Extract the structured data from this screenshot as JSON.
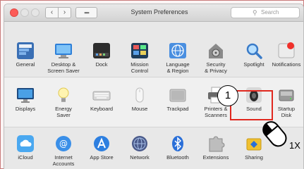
{
  "window": {
    "title": "System Preferences",
    "search_placeholder": "Search",
    "back_glyph": "‹",
    "forward_glyph": "›",
    "grid_glyph": "▪▪▪"
  },
  "row1": [
    {
      "label": "General",
      "icon": "general-icon"
    },
    {
      "label": "Desktop &\nScreen Saver",
      "icon": "desktop-icon"
    },
    {
      "label": "Dock",
      "icon": "dock-icon"
    },
    {
      "label": "Mission\nControl",
      "icon": "mission-control-icon"
    },
    {
      "label": "Language\n& Region",
      "icon": "language-region-icon"
    },
    {
      "label": "Security\n& Privacy",
      "icon": "security-icon"
    },
    {
      "label": "Spotlight",
      "icon": "spotlight-icon"
    },
    {
      "label": "Notifications",
      "icon": "notifications-icon"
    }
  ],
  "row2": [
    {
      "label": "Displays",
      "icon": "displays-icon"
    },
    {
      "label": "Energy\nSaver",
      "icon": "energy-saver-icon"
    },
    {
      "label": "Keyboard",
      "icon": "keyboard-icon"
    },
    {
      "label": "Mouse",
      "icon": "mouse-icon"
    },
    {
      "label": "Trackpad",
      "icon": "trackpad-icon"
    },
    {
      "label": "Printers &\nScanners",
      "icon": "printer-icon"
    },
    {
      "label": "Sound",
      "icon": "sound-icon"
    },
    {
      "label": "Startup\nDisk",
      "icon": "startup-disk-icon"
    }
  ],
  "row3": [
    {
      "label": "iCloud",
      "icon": "icloud-icon"
    },
    {
      "label": "Internet\nAccounts",
      "icon": "internet-accounts-icon"
    },
    {
      "label": "App Store",
      "icon": "app-store-icon"
    },
    {
      "label": "Network",
      "icon": "network-icon"
    },
    {
      "label": "Bluetooth",
      "icon": "bluetooth-icon"
    },
    {
      "label": "Extensions",
      "icon": "extensions-icon"
    },
    {
      "label": "Sharing",
      "icon": "sharing-icon"
    }
  ],
  "annotation": {
    "step_number": "1",
    "click_count": "1X"
  },
  "colors": {
    "highlight": "#e0281f",
    "close_light": "#fc5b57"
  }
}
